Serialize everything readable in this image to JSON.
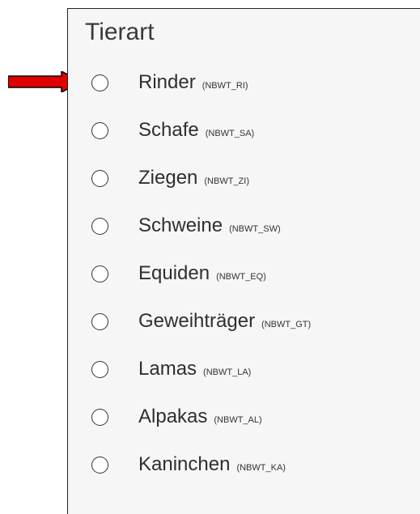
{
  "panel": {
    "title": "Tierart"
  },
  "options": [
    {
      "label": "Rinder",
      "code": "(NBWT_RI)"
    },
    {
      "label": "Schafe",
      "code": "(NBWT_SA)"
    },
    {
      "label": "Ziegen",
      "code": "(NBWT_ZI)"
    },
    {
      "label": "Schweine",
      "code": "(NBWT_SW)"
    },
    {
      "label": "Equiden",
      "code": "(NBWT_EQ)"
    },
    {
      "label": "Geweihträger",
      "code": "(NBWT_GT)"
    },
    {
      "label": "Lamas",
      "code": "(NBWT_LA)"
    },
    {
      "label": "Alpakas",
      "code": "(NBWT_AL)"
    },
    {
      "label": "Kaninchen",
      "code": "(NBWT_KA)"
    }
  ],
  "annotation": {
    "arrow_color": "#e00000",
    "arrow_icon": "right-arrow-icon"
  }
}
